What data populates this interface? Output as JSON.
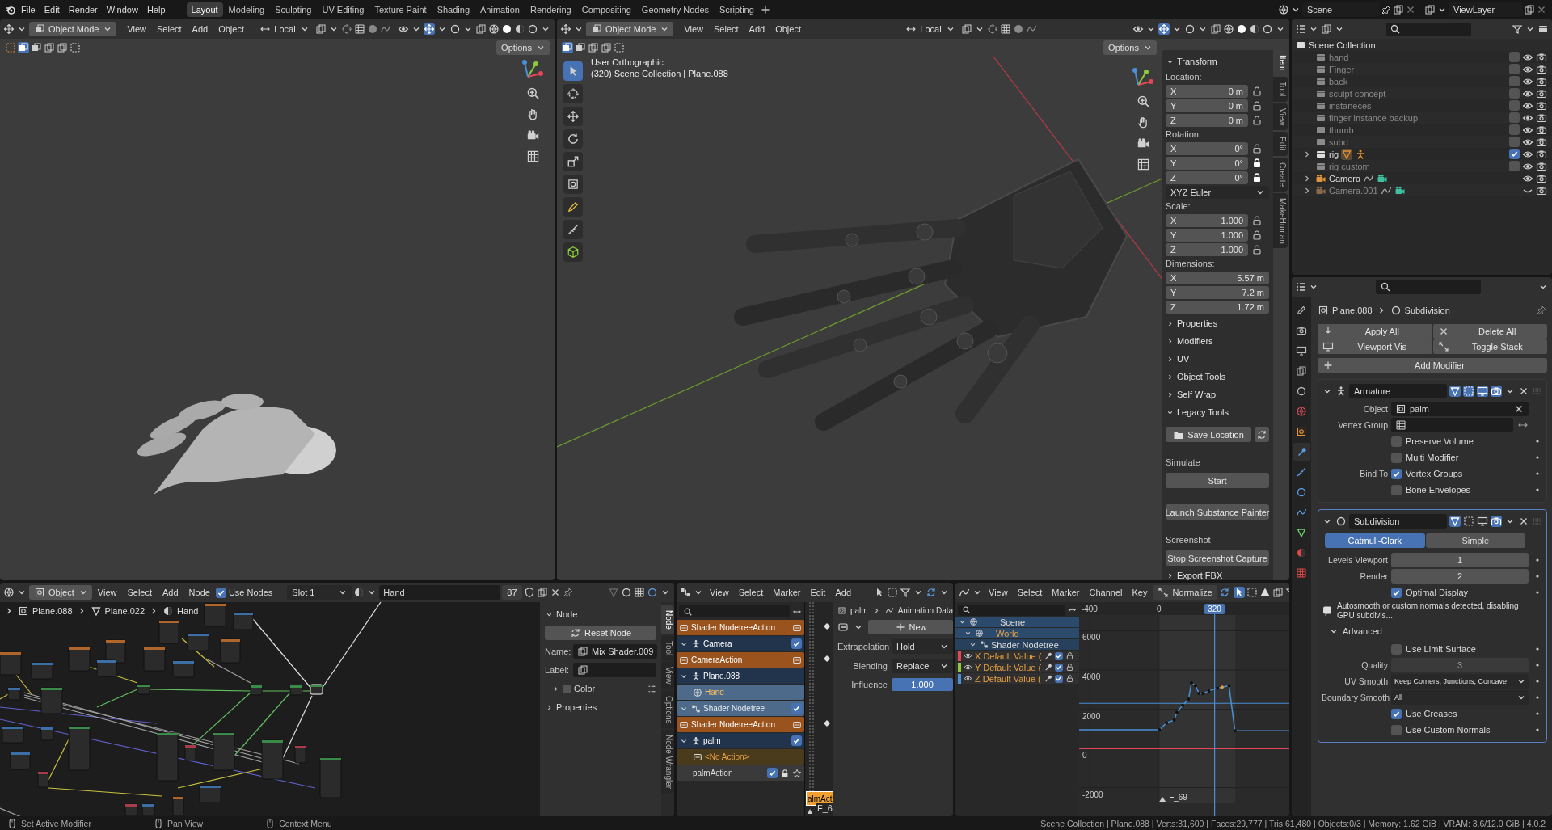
{
  "topbar": {
    "menus": [
      "File",
      "Edit",
      "Render",
      "Window",
      "Help"
    ],
    "workspaces": [
      {
        "label": "Layout",
        "selected": true
      },
      {
        "label": "Modeling",
        "selected": false
      },
      {
        "label": "Sculpting",
        "selected": false
      },
      {
        "label": "UV Editing",
        "selected": false
      },
      {
        "label": "Texture Paint",
        "selected": false
      },
      {
        "label": "Shading",
        "selected": false
      },
      {
        "label": "Animation",
        "selected": false
      },
      {
        "label": "Rendering",
        "selected": false
      },
      {
        "label": "Compositing",
        "selected": false
      },
      {
        "label": "Geometry Nodes",
        "selected": false
      },
      {
        "label": "Scripting",
        "selected": false
      }
    ],
    "scene": "Scene",
    "view_layer": "ViewLayer"
  },
  "viewports": [
    {
      "kind": "secondary",
      "mode": "Object Mode",
      "menus": [
        "View",
        "Select",
        "Add",
        "Object"
      ],
      "orientation": "Local",
      "options": "Options"
    },
    {
      "kind": "main",
      "mode": "Object Mode",
      "menus": [
        "View",
        "Select",
        "Add",
        "Object"
      ],
      "orientation": "Local",
      "options": "Options",
      "overlay": [
        "User Orthographic",
        "(320) Scene Collection | Plane.088"
      ]
    }
  ],
  "n_panel": {
    "tabs": [
      {
        "label": "Item",
        "selected": true
      },
      {
        "label": "Tool",
        "selected": false
      },
      {
        "label": "View",
        "selected": false
      },
      {
        "label": "Edit",
        "selected": false
      },
      {
        "label": "Create",
        "selected": false
      },
      {
        "label": "MakeHuman",
        "selected": false
      }
    ],
    "items": [
      {
        "kind": "header",
        "label": "Transform",
        "expanded": true
      },
      {
        "kind": "label",
        "label": "Location:"
      },
      {
        "kind": "field",
        "axis": "X",
        "value": "0 m",
        "locked": false
      },
      {
        "kind": "field",
        "axis": "Y",
        "value": "0 m",
        "locked": false
      },
      {
        "kind": "field",
        "axis": "Z",
        "value": "0 m",
        "locked": false
      },
      {
        "kind": "label",
        "label": "Rotation:"
      },
      {
        "kind": "field",
        "axis": "X",
        "value": "0°",
        "locked": false
      },
      {
        "kind": "field",
        "axis": "Y",
        "value": "0°",
        "locked": true
      },
      {
        "kind": "field",
        "axis": "Z",
        "value": "0°",
        "locked": true
      },
      {
        "kind": "dropdown",
        "value": "XYZ Euler"
      },
      {
        "kind": "label",
        "label": "Scale:"
      },
      {
        "kind": "field",
        "axis": "X",
        "value": "1.000",
        "locked": false
      },
      {
        "kind": "field",
        "axis": "Y",
        "value": "1.000",
        "locked": false
      },
      {
        "kind": "field",
        "axis": "Z",
        "value": "1.000",
        "locked": false
      },
      {
        "kind": "label",
        "label": "Dimensions:"
      },
      {
        "kind": "dim",
        "axis": "X",
        "value": "5.57 m"
      },
      {
        "kind": "dim",
        "axis": "Y",
        "value": "7.2 m"
      },
      {
        "kind": "dim",
        "axis": "Z",
        "value": "1.72 m"
      },
      {
        "kind": "header",
        "label": "Properties",
        "expanded": false
      },
      {
        "kind": "header",
        "label": "Modifiers",
        "expanded": false
      },
      {
        "kind": "header",
        "label": "UV",
        "expanded": false
      },
      {
        "kind": "header",
        "label": "Object Tools",
        "expanded": false
      },
      {
        "kind": "header",
        "label": "Self Wrap",
        "expanded": false
      },
      {
        "kind": "header",
        "label": "Legacy Tools",
        "expanded": true
      },
      {
        "kind": "path-button",
        "label": "Save Location"
      },
      {
        "kind": "section",
        "label": "Simulate"
      },
      {
        "kind": "button",
        "label": "Start"
      },
      {
        "kind": "spaced-button",
        "label": "Launch Substance Painter"
      },
      {
        "kind": "section",
        "label": "Screenshot"
      },
      {
        "kind": "button",
        "label": "Stop Screenshot Capture"
      },
      {
        "kind": "header",
        "label": "Export FBX",
        "expanded": false
      }
    ]
  },
  "outliner": {
    "root": "Scene Collection",
    "items": [
      {
        "kind": "collection",
        "name": "hand",
        "checked": false,
        "visible": true,
        "expandable": false
      },
      {
        "kind": "collection",
        "name": "Finger",
        "checked": false,
        "visible": true,
        "expandable": false
      },
      {
        "kind": "collection",
        "name": "back",
        "checked": false,
        "visible": true,
        "expandable": false
      },
      {
        "kind": "collection",
        "name": "sculpt concept",
        "checked": false,
        "visible": true,
        "expandable": false
      },
      {
        "kind": "collection",
        "name": "instaneces",
        "checked": false,
        "visible": true,
        "expandable": false
      },
      {
        "kind": "collection",
        "name": "finger instance backup",
        "checked": false,
        "visible": true,
        "expandable": false
      },
      {
        "kind": "collection",
        "name": "thumb",
        "checked": false,
        "visible": true,
        "expandable": false
      },
      {
        "kind": "collection",
        "name": "subd",
        "checked": false,
        "visible": true,
        "expandable": false
      },
      {
        "kind": "collection",
        "name": "rig",
        "checked": true,
        "visible": true,
        "expandable": true
      },
      {
        "kind": "collection",
        "name": "rig custom",
        "checked": false,
        "visible": true,
        "expandable": false
      },
      {
        "kind": "camera",
        "name": "Camera",
        "visible": true,
        "expandable": true
      },
      {
        "kind": "camera",
        "name": "Camera.001",
        "visible": false,
        "expandable": true
      }
    ]
  },
  "properties": {
    "tabs": [
      {
        "kind": "tool",
        "selected": false
      },
      {
        "kind": "render",
        "selected": false
      },
      {
        "kind": "output",
        "selected": false
      },
      {
        "kind": "view_layer",
        "selected": false
      },
      {
        "kind": "scene",
        "selected": false
      },
      {
        "kind": "world",
        "selected": false
      },
      {
        "kind": "object",
        "selected": false
      },
      {
        "kind": "modifiers",
        "selected": true
      },
      {
        "kind": "particles",
        "selected": false
      },
      {
        "kind": "physics",
        "selected": false
      },
      {
        "kind": "constraints",
        "selected": false
      },
      {
        "kind": "data",
        "selected": false
      },
      {
        "kind": "material",
        "selected": false
      },
      {
        "kind": "texture",
        "selected": false
      }
    ],
    "breadcrumb": [
      "Plane.088",
      "Subdivision"
    ],
    "actions": [
      "Apply All",
      "Delete All",
      "Viewport Vis",
      "Toggle Stack"
    ],
    "add_modifier": "Add Modifier",
    "modifiers": [
      {
        "kind": "armature",
        "name": "Armature",
        "expanded": true,
        "active": false,
        "rows": [
          {
            "kind": "object",
            "label": "Object",
            "value": "palm"
          },
          {
            "kind": "vgroup",
            "label": "Vertex Group"
          },
          {
            "kind": "check",
            "text": "Preserve Volume",
            "checked": false
          },
          {
            "kind": "check",
            "text": "Multi Modifier",
            "checked": false
          },
          {
            "kind": "check",
            "label": "Bind To",
            "text": "Vertex Groups",
            "checked": true
          },
          {
            "kind": "check",
            "text": "Bone Envelopes",
            "checked": false
          }
        ]
      },
      {
        "kind": "subdivision",
        "name": "Subdivision",
        "expanded": true,
        "active": true,
        "rows": [
          {
            "kind": "toggle",
            "options": [
              {
                "label": "Catmull-Clark",
                "selected": true
              },
              {
                "label": "Simple",
                "selected": false
              }
            ]
          },
          {
            "kind": "number",
            "label": "Levels Viewport",
            "value": "1",
            "disabled": false
          },
          {
            "kind": "number",
            "label": "Render",
            "value": "2",
            "disabled": false
          },
          {
            "kind": "check",
            "text": "Optimal Display",
            "checked": true
          },
          {
            "kind": "warning",
            "text": "Autosmooth or custom normals detected, disabling GPU subdivis..."
          },
          {
            "kind": "subpanel",
            "label": "Advanced",
            "expanded": true
          },
          {
            "kind": "check",
            "text": "Use Limit Surface",
            "checked": false
          },
          {
            "kind": "number",
            "label": "Quality",
            "value": "3",
            "disabled": true
          },
          {
            "kind": "select",
            "label": "UV Smooth",
            "value": "Keep Corners, Junctions, Concave"
          },
          {
            "kind": "select",
            "label": "Boundary Smooth",
            "value": "All"
          },
          {
            "kind": "check",
            "text": "Use Creases",
            "checked": true
          },
          {
            "kind": "check",
            "text": "Use Custom Normals",
            "checked": false
          }
        ]
      }
    ]
  },
  "node_editor": {
    "type_menu": "Object",
    "menus": [
      "View",
      "Select",
      "Add",
      "Node"
    ],
    "use_nodes": {
      "label": "Use Nodes",
      "checked": true
    },
    "slot": "Slot 1",
    "material": "Hand",
    "users": "87",
    "breadcrumb": [
      "Plane.088",
      "Plane.022",
      "Hand"
    ],
    "sidebar": {
      "tabs": [
        {
          "label": "Node",
          "selected": true
        },
        {
          "label": "Tool",
          "selected": false
        },
        {
          "label": "View",
          "selected": false
        },
        {
          "label": "Options",
          "selected": false
        },
        {
          "label": "Node Wrangler",
          "selected": false
        }
      ],
      "panel": {
        "label": "Node",
        "expanded": true
      },
      "reset": "Reset Node",
      "name_label": "Name:",
      "name": "Mix Shader.009",
      "label_label": "Label:",
      "color": {
        "label": "Color",
        "expanded": false
      },
      "properties": {
        "label": "Properties",
        "expanded": false
      }
    }
  },
  "nla": {
    "menus": [
      "View",
      "Select",
      "Marker",
      "Edit",
      "Add"
    ],
    "tracks": [
      {
        "kind": "action",
        "name": "Shader NodetreeAction"
      },
      {
        "kind": "object",
        "name": "Camera",
        "checked": true
      },
      {
        "kind": "action",
        "name": "CameraAction"
      },
      {
        "kind": "object",
        "name": "Plane.088"
      },
      {
        "kind": "material",
        "name": "Hand"
      },
      {
        "kind": "nodetree",
        "name": "Shader Nodetree",
        "checked": true
      },
      {
        "kind": "action",
        "name": "Shader NodetreeAction"
      },
      {
        "kind": "object",
        "name": "palm",
        "checked": true
      },
      {
        "kind": "noaction",
        "name": "<No Action>"
      },
      {
        "kind": "track",
        "name": "palmAction",
        "checked": true
      }
    ],
    "strip_label": "almActi",
    "marker": "F_6",
    "panel": {
      "breadcrumb": [
        "palm",
        "Animation Data"
      ],
      "new": "New",
      "extrapolation": {
        "label": "Extrapolation",
        "value": "Hold"
      },
      "blending": {
        "label": "Blending",
        "value": "Replace"
      },
      "influence": {
        "label": "Influence",
        "reading": "1.000",
        "level": 1
      }
    }
  },
  "graph_editor": {
    "menus": [
      "View",
      "Select",
      "Marker",
      "Channel",
      "Key"
    ],
    "normalize": "Normalize",
    "channels": [
      {
        "kind": "scene",
        "name": "Scene"
      },
      {
        "kind": "world",
        "name": "World"
      },
      {
        "kind": "nodetree",
        "name": "Shader Nodetree"
      },
      {
        "kind": "fcurve",
        "name": "X Default Value (",
        "color": "#e64658",
        "checked": true
      },
      {
        "kind": "fcurve",
        "name": "Y Default Value (",
        "color": "#8ccc3a",
        "checked": true
      },
      {
        "kind": "fcurve",
        "name": "Z Default Value (",
        "color": "#4a90d9",
        "checked": true
      }
    ],
    "current_frame": "320",
    "marker": "F_69",
    "chart_data": {
      "type": "line",
      "x": [
        -460,
        3,
        43,
        87,
        103,
        137,
        170,
        187,
        210,
        230,
        253,
        287,
        337,
        363,
        403,
        437,
        750
      ],
      "series": [
        {
          "color": "#e64658",
          "values": [
            0,
            0,
            0,
            0,
            0,
            0,
            0,
            0,
            0,
            0,
            0,
            0,
            0,
            0,
            0,
            0,
            0
          ]
        },
        {
          "color": "#4a90d9",
          "values": [
            950,
            950,
            1300,
            1440,
            1850,
            2200,
            2520,
            3340,
            3200,
            2800,
            2800,
            2930,
            3070,
            3120,
            3200,
            900,
            900
          ]
        }
      ],
      "xlim": [
        -460,
        750
      ],
      "ylim": [
        -2800,
        6800
      ],
      "xticks": [
        -400,
        0
      ],
      "grid": true,
      "ref_lines": [
        {
          "axis": "x",
          "value": 320,
          "color": "#4a90d9"
        },
        {
          "axis": "y",
          "value": 2300,
          "color": "#4a90d9"
        }
      ],
      "bands": [
        {
          "axis": "x",
          "from": 0,
          "to": 440,
          "color": "#333333"
        }
      ],
      "yticks": [
        -2000,
        0,
        2000,
        4000,
        6000
      ]
    }
  },
  "status_bar": {
    "hints": [
      "Set Active Modifier",
      "Pan View",
      "Context Menu"
    ],
    "stats": "Scene Collection | Plane.088 | Verts:31,600 | Faces:29,777 | Tris:61,480 | Objects:0/3 | Memory: 1.62 GiB | VRAM: 3.6/12.0 GiB | 4.0.2"
  }
}
